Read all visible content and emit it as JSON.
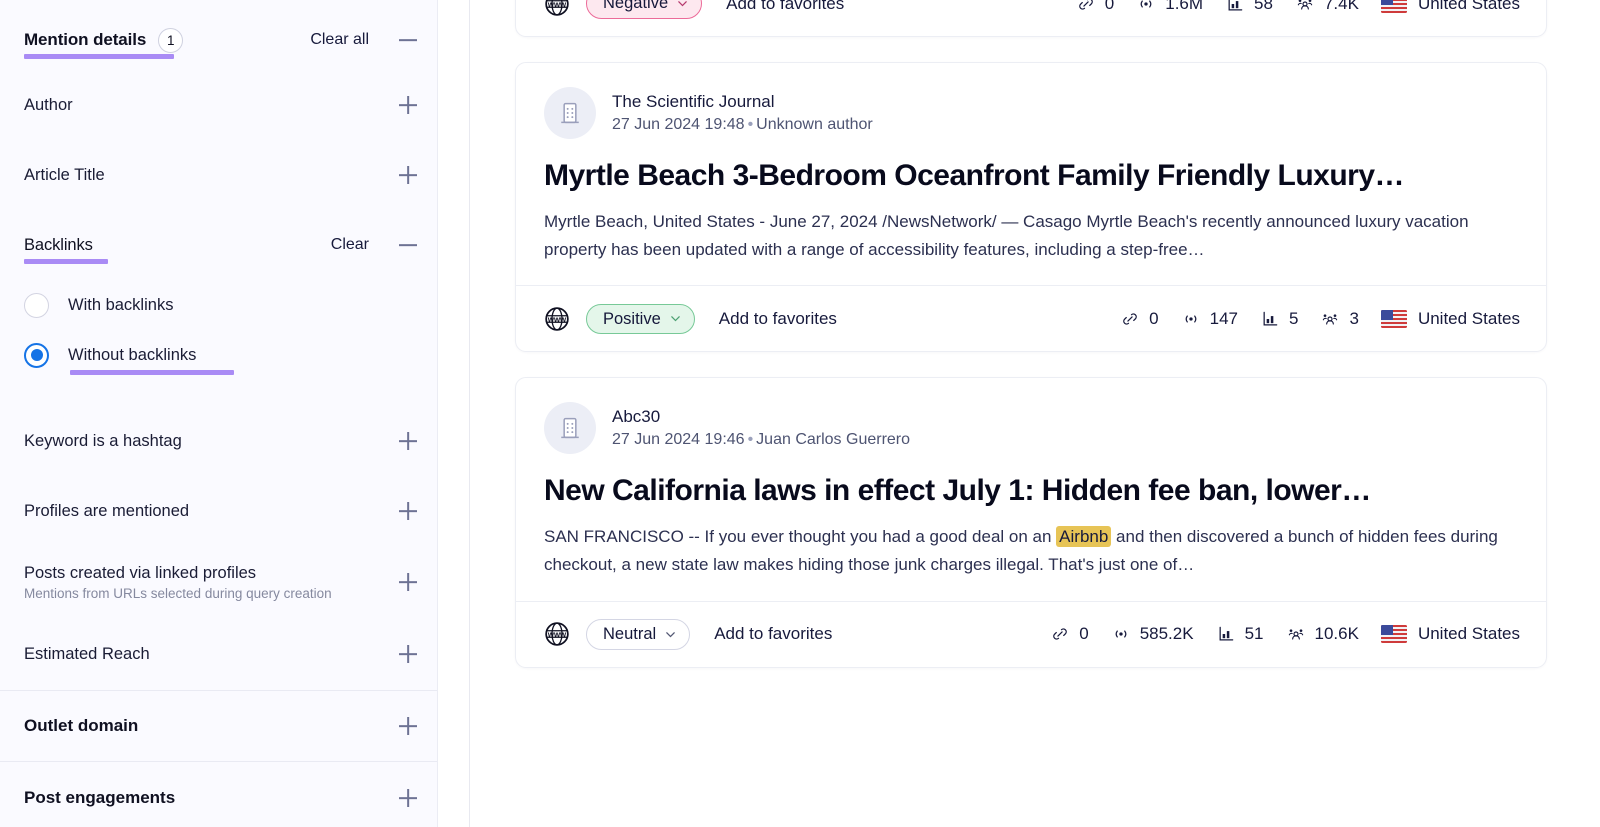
{
  "sidebar": {
    "mention_details": {
      "title": "Mention details",
      "count": "1",
      "clear_label": "Clear all",
      "toggle": "minus"
    },
    "filters": [
      {
        "label": "Author",
        "toggle": "plus",
        "sub": null
      },
      {
        "label": "Article Title",
        "toggle": "plus",
        "sub": null
      }
    ],
    "backlinks": {
      "title": "Backlinks",
      "clear_label": "Clear",
      "toggle": "minus",
      "options": [
        {
          "label": "With backlinks",
          "selected": false
        },
        {
          "label": "Without backlinks",
          "selected": true
        }
      ]
    },
    "filters2": [
      {
        "label": "Keyword is a hashtag",
        "toggle": "plus",
        "sub": null
      },
      {
        "label": "Profiles are mentioned",
        "toggle": "plus",
        "sub": null
      },
      {
        "label": "Posts created via linked profiles",
        "toggle": "plus",
        "sub": "Mentions from URLs selected during query creation"
      },
      {
        "label": "Estimated Reach",
        "toggle": "plus",
        "sub": null
      }
    ],
    "sections": [
      {
        "label": "Outlet domain",
        "toggle": "plus"
      },
      {
        "label": "Post engagements",
        "toggle": "plus"
      }
    ]
  },
  "main": {
    "cards": [
      {
        "id": "card-partial",
        "partial": true,
        "footer": {
          "sentiment": "Negative",
          "sentiment_kind": "negative",
          "favorites_label": "Add to favorites",
          "stats": [
            {
              "icon": "link-icon",
              "value": "0"
            },
            {
              "icon": "reach-icon",
              "value": "1.6M"
            },
            {
              "icon": "chart-icon",
              "value": "58"
            },
            {
              "icon": "audience-icon",
              "value": "7.4K"
            }
          ],
          "country": "United States",
          "country_flag": "us-flag-icon"
        }
      },
      {
        "id": "card-scientific-journal",
        "partial": false,
        "outlet": "The Scientific Journal",
        "timestamp": "27 Jun 2024 19:48",
        "author": "Unknown author",
        "title": "Myrtle Beach 3-Bedroom Oceanfront Family Friendly Luxury…",
        "snippet_pre": "Myrtle Beach, United States - June 27, 2024 /NewsNetwork/ — Casago Myrtle Beach's recently announced luxury vacation property has been updated with a range of accessibility features, including a step-free…",
        "highlight": null,
        "snippet_post": null,
        "footer": {
          "sentiment": "Positive",
          "sentiment_kind": "positive",
          "favorites_label": "Add to favorites",
          "stats": [
            {
              "icon": "link-icon",
              "value": "0"
            },
            {
              "icon": "reach-icon",
              "value": "147"
            },
            {
              "icon": "chart-icon",
              "value": "5"
            },
            {
              "icon": "audience-icon",
              "value": "3"
            }
          ],
          "country": "United States",
          "country_flag": "us-flag-icon"
        }
      },
      {
        "id": "card-abc30",
        "partial": false,
        "outlet": "Abc30",
        "timestamp": "27 Jun 2024 19:46",
        "author": "Juan Carlos Guerrero",
        "title": "New California laws in effect July 1: Hidden fee ban, lower…",
        "snippet_pre": "SAN FRANCISCO -- If you ever thought you had a good deal on an ",
        "highlight": "Airbnb",
        "snippet_post": " and then discovered a bunch of hidden fees during checkout, a new state law makes hiding those junk charges illegal. That's just one of…",
        "footer": {
          "sentiment": "Neutral",
          "sentiment_kind": "neutral",
          "favorites_label": "Add to favorites",
          "stats": [
            {
              "icon": "link-icon",
              "value": "0"
            },
            {
              "icon": "reach-icon",
              "value": "585.2K"
            },
            {
              "icon": "chart-icon",
              "value": "51"
            },
            {
              "icon": "audience-icon",
              "value": "10.6K"
            }
          ],
          "country": "United States",
          "country_flag": "us-flag-icon"
        }
      }
    ]
  },
  "colors": {
    "accent_purple": "#a98bf5",
    "radio_blue": "#1573e6",
    "highlight_gold": "#e7c456",
    "negative_border": "#ec6b99",
    "negative_bg": "#fde8ef",
    "positive_border": "#77c997",
    "positive_bg": "#e4f6ea",
    "neutral_border": "#d4d6e4"
  }
}
